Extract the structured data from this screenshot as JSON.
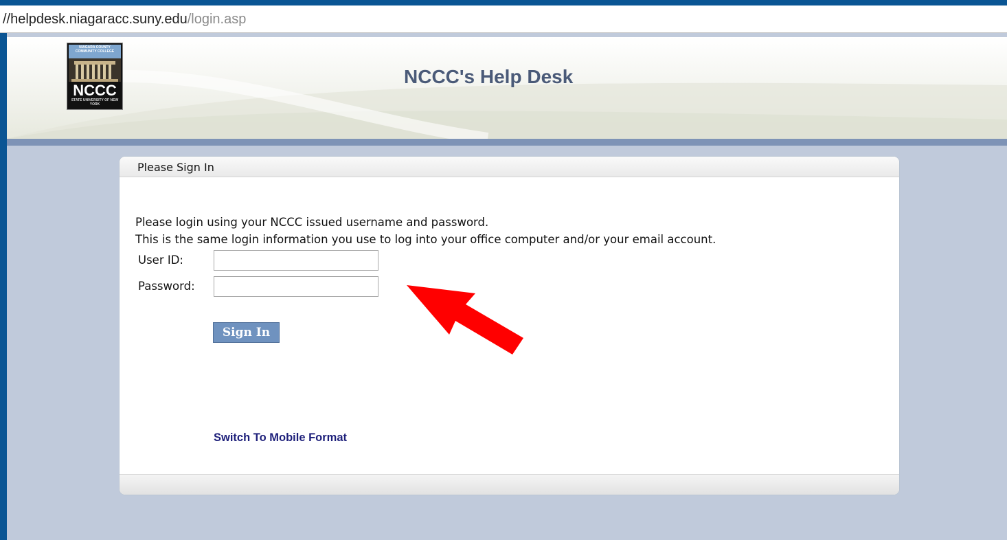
{
  "browser": {
    "address_host": "//helpdesk.niagaracc.suny.edu",
    "address_path": "/login.asp"
  },
  "header": {
    "logo": {
      "top_text": "NIAGARA COUNTY COMMUNITY COLLEGE",
      "main_text": "NCCC",
      "sub_text": "STATE UNIVERSITY OF NEW YORK"
    },
    "title": "NCCC's Help Desk"
  },
  "login_panel": {
    "title": "Please Sign In",
    "instruction_line1": "Please login using your NCCC issued username and password.",
    "instruction_line2": "This is the same login information you use to log into your office computer and/or your email account.",
    "userid_label": "User ID:",
    "userid_value": "",
    "password_label": "Password:",
    "password_value": "",
    "signin_label": "Sign In",
    "mobile_link": "Switch To Mobile Format"
  },
  "colors": {
    "frame": "#0a5594",
    "page_background": "#c0cadb",
    "header_rule": "#7e93b6",
    "title": "#4a5a78",
    "button": "#6f92bf",
    "link": "#1d1f7a",
    "annotation_arrow": "#ff0000"
  },
  "annotation": {
    "icon": "red-arrow-icon"
  }
}
